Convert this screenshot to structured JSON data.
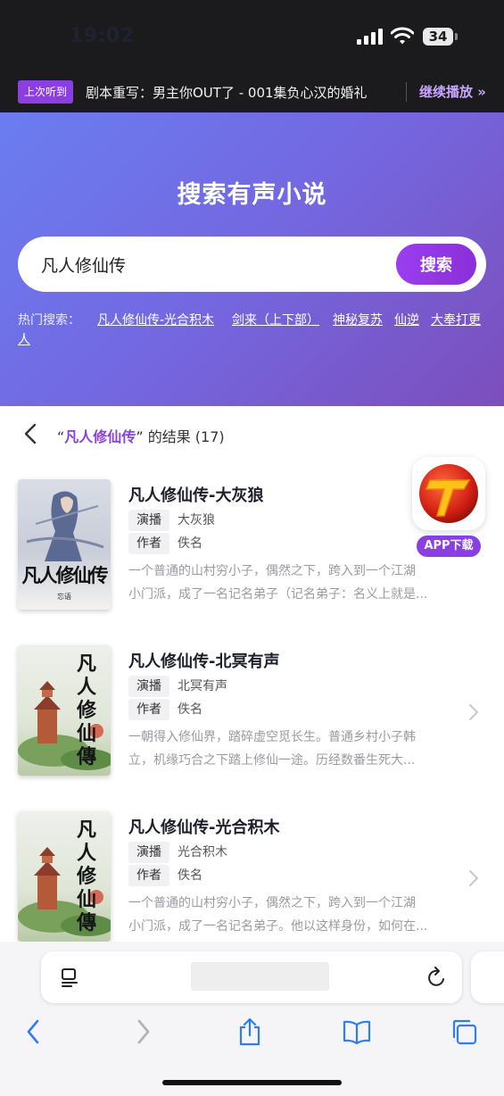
{
  "status_bar": {
    "time": "19:02",
    "battery": "34"
  },
  "recent": {
    "badge": "上次听到",
    "title": "剧本重写：男主你OUT了 - 001集负心汉的婚礼",
    "continue": "继续播放 »"
  },
  "hero": {
    "title": "搜索有声小说"
  },
  "search": {
    "value": "凡人修仙传",
    "button": "搜索"
  },
  "hot": {
    "label": "热门搜索：",
    "items": [
      "凡人修仙传-光合积木",
      "剑来（上下部）",
      "神秘复苏",
      "仙逆",
      "大奉打更",
      "人"
    ]
  },
  "results": {
    "open_quote": "“",
    "keyword": "凡人修仙传",
    "suffix": "” 的结果 (17)"
  },
  "labels": {
    "narrator": "演播",
    "author": "作者"
  },
  "books": [
    {
      "title": "凡人修仙传-大灰狼",
      "narrator": "大灰狼",
      "author": "佚名",
      "desc1": "一个普通的山村穷小子，偶然之下，跨入到一个江湖",
      "desc2": "小门派，成了一名记名弟子（记名弟子：名义上就是...",
      "cover_text": "凡人修仙传",
      "cover_subtitle": "忘语"
    },
    {
      "title": "凡人修仙传-北冥有声",
      "narrator": "北冥有声",
      "author": "佚名",
      "desc1": "一朝得入修仙界，踏碎虚空觅长生。普通乡村小子韩",
      "desc2": "立，机缘巧合之下踏上修仙一途。历经数番生死大...",
      "cover_text": "凡人修仙傳"
    },
    {
      "title": "凡人修仙传-光合积木",
      "narrator": "光合积木",
      "author": "佚名",
      "desc1": "一个普通的山村穷小子，偶然之下，跨入到一个江湖",
      "desc2": "小门派，成了一名记名弟子。他以这样身份，如何在...",
      "cover_text": "凡人修仙傳"
    }
  ],
  "app_promo": {
    "button": "APP下载"
  },
  "colors": {
    "accent": "#8a3fe0",
    "hero_start": "#6a7df0",
    "hero_end": "#7c4ebc",
    "ios_blue": "#2f7cf6"
  },
  "icons": [
    "back-icon",
    "chevron-right-icon",
    "reader-icon",
    "reload-icon",
    "share-icon",
    "bookmarks-icon",
    "tabs-icon"
  ]
}
